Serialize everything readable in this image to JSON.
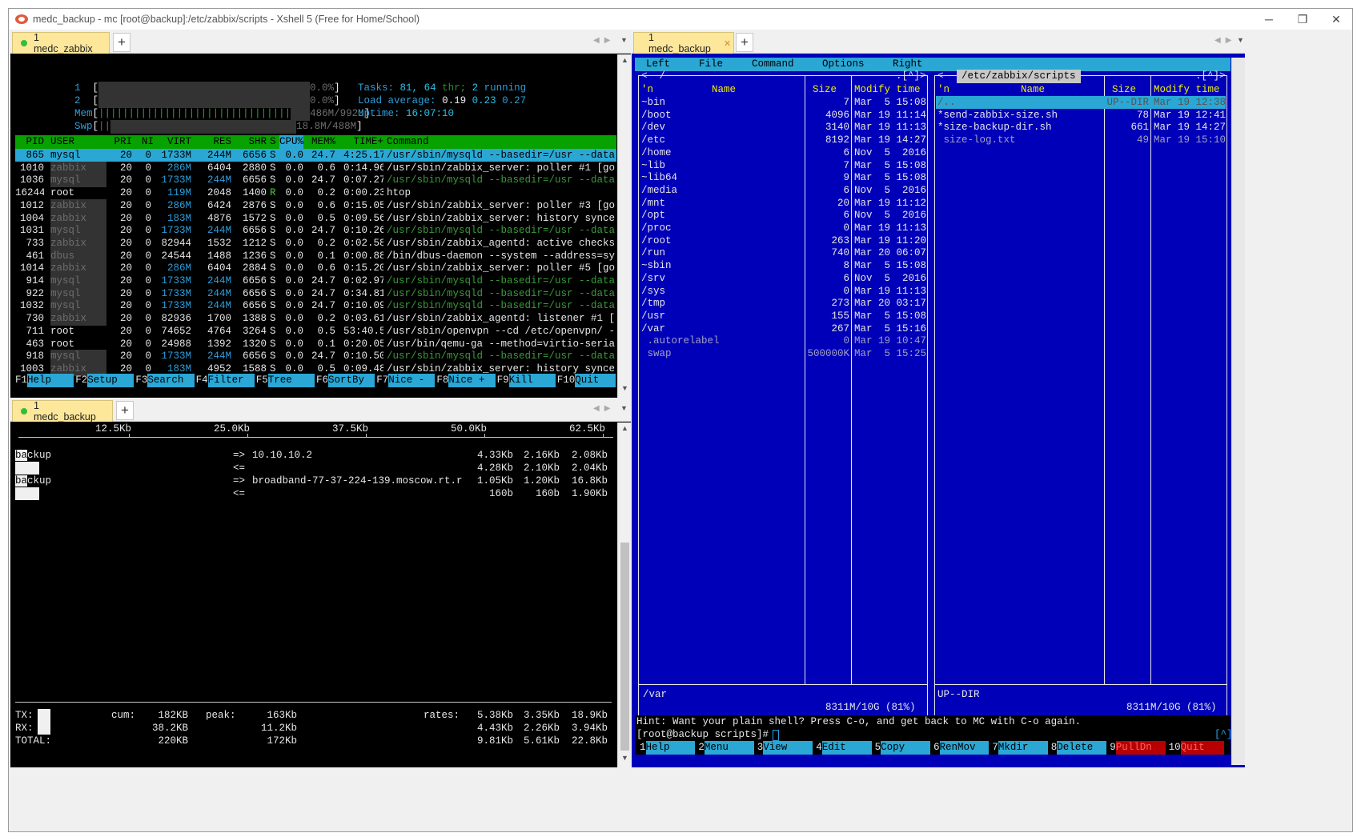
{
  "window": {
    "title": "medc_backup - mc [root@backup]:/etc/zabbix/scripts - Xshell 5 (Free for Home/School)",
    "controls": {
      "minimize": "─",
      "restore": "❐",
      "close": "✕"
    }
  },
  "colors": {
    "htop_header": "#07a100",
    "selection": "#2aa7d5",
    "mc_background": "#0000b8",
    "tab_active": "#fde79a"
  },
  "top_left_pane": {
    "tab_label": "1 medc_zabbix",
    "htop": {
      "cpu1": {
        "num": "1",
        "value": "0.0%"
      },
      "cpu2": {
        "num": "2",
        "value": "0.0%"
      },
      "mem": {
        "label": "Mem",
        "value": "486M/992M"
      },
      "swp": {
        "label": "Swp",
        "value": "18.8M/488M"
      },
      "tasks": {
        "label": "Tasks:",
        "count": "81,",
        "thr": "64",
        "thr_label": "thr;",
        "running": "2",
        "running_label": "running"
      },
      "load": {
        "label": "Load average:",
        "v1": "0.19",
        "v2": "0.23",
        "v3": "0.27"
      },
      "uptime": {
        "label": "Uptime:",
        "value": "16:07:10"
      },
      "columns": [
        "PID",
        "USER",
        "PRI",
        "NI",
        "VIRT",
        "RES",
        "SHR",
        "S",
        "CPU%",
        "MEM%",
        "TIME+",
        "Command"
      ],
      "rows": [
        [
          "865",
          "mysql",
          "20",
          "0",
          "1733M",
          "244M",
          "6656",
          "S",
          "0.0",
          "24.7",
          "4:25.17",
          "/usr/sbin/mysqld --basedir=/usr --data"
        ],
        [
          "1010",
          "zabbix",
          "20",
          "0",
          "286M",
          "6404",
          "2880",
          "S",
          "0.0",
          "0.6",
          "0:14.96",
          "/usr/sbin/zabbix_server: poller #1 [go"
        ],
        [
          "1036",
          "mysql",
          "20",
          "0",
          "1733M",
          "244M",
          "6656",
          "S",
          "0.0",
          "24.7",
          "0:07.27",
          "/usr/sbin/mysqld --basedir=/usr --data"
        ],
        [
          "16244",
          "root",
          "20",
          "0",
          "119M",
          "2048",
          "1400",
          "R",
          "0.0",
          "0.2",
          "0:00.23",
          "htop"
        ],
        [
          "1012",
          "zabbix",
          "20",
          "0",
          "286M",
          "6424",
          "2876",
          "S",
          "0.0",
          "0.6",
          "0:15.05",
          "/usr/sbin/zabbix_server: poller #3 [go"
        ],
        [
          "1004",
          "zabbix",
          "20",
          "0",
          "183M",
          "4876",
          "1572",
          "S",
          "0.0",
          "0.5",
          "0:09.56",
          "/usr/sbin/zabbix_server: history synce"
        ],
        [
          "1031",
          "mysql",
          "20",
          "0",
          "1733M",
          "244M",
          "6656",
          "S",
          "0.0",
          "24.7",
          "0:10.26",
          "/usr/sbin/mysqld --basedir=/usr --data"
        ],
        [
          "733",
          "zabbix",
          "20",
          "0",
          "82944",
          "1532",
          "1212",
          "S",
          "0.0",
          "0.2",
          "0:02.58",
          "/usr/sbin/zabbix_agentd: active checks"
        ],
        [
          "461",
          "dbus",
          "20",
          "0",
          "24544",
          "1488",
          "1236",
          "S",
          "0.0",
          "0.1",
          "0:00.88",
          "/bin/dbus-daemon --system --address=sy"
        ],
        [
          "1014",
          "zabbix",
          "20",
          "0",
          "286M",
          "6404",
          "2884",
          "S",
          "0.0",
          "0.6",
          "0:15.20",
          "/usr/sbin/zabbix_server: poller #5 [go"
        ],
        [
          "914",
          "mysql",
          "20",
          "0",
          "1733M",
          "244M",
          "6656",
          "S",
          "0.0",
          "24.7",
          "0:02.97",
          "/usr/sbin/mysqld --basedir=/usr --data"
        ],
        [
          "922",
          "mysql",
          "20",
          "0",
          "1733M",
          "244M",
          "6656",
          "S",
          "0.0",
          "24.7",
          "0:34.81",
          "/usr/sbin/mysqld --basedir=/usr --data"
        ],
        [
          "1032",
          "mysql",
          "20",
          "0",
          "1733M",
          "244M",
          "6656",
          "S",
          "0.0",
          "24.7",
          "0:10.09",
          "/usr/sbin/mysqld --basedir=/usr --data"
        ],
        [
          "730",
          "zabbix",
          "20",
          "0",
          "82936",
          "1700",
          "1388",
          "S",
          "0.0",
          "0.2",
          "0:03.61",
          "/usr/sbin/zabbix_agentd: listener #1 ["
        ],
        [
          "711",
          "root",
          "20",
          "0",
          "74652",
          "4764",
          "3264",
          "S",
          "0.0",
          "0.5",
          "53:40.54",
          "/usr/sbin/openvpn --cd /etc/openvpn/ -"
        ],
        [
          "463",
          "root",
          "20",
          "0",
          "24988",
          "1392",
          "1320",
          "S",
          "0.0",
          "0.1",
          "0:20.05",
          "/usr/bin/qemu-ga --method=virtio-seria"
        ],
        [
          "918",
          "mysql",
          "20",
          "0",
          "1733M",
          "244M",
          "6656",
          "S",
          "0.0",
          "24.7",
          "0:10.50",
          "/usr/sbin/mysqld --basedir=/usr --data"
        ],
        [
          "1003",
          "zabbix",
          "20",
          "0",
          "183M",
          "4952",
          "1588",
          "S",
          "0.0",
          "0.5",
          "0:09.48",
          "/usr/sbin/zabbix_server: history synce"
        ]
      ],
      "fkeys": [
        {
          "key": "F1",
          "label": "Help"
        },
        {
          "key": "F2",
          "label": "Setup"
        },
        {
          "key": "F3",
          "label": "Search"
        },
        {
          "key": "F4",
          "label": "Filter"
        },
        {
          "key": "F5",
          "label": "Tree"
        },
        {
          "key": "F6",
          "label": "SortBy"
        },
        {
          "key": "F7",
          "label": "Nice -"
        },
        {
          "key": "F8",
          "label": "Nice +"
        },
        {
          "key": "F9",
          "label": "Kill"
        },
        {
          "key": "F10",
          "label": "Quit"
        }
      ]
    }
  },
  "bottom_left_pane": {
    "tab_label": "1 medc_backup",
    "iftop": {
      "scale": [
        "12.5Kb",
        "25.0Kb",
        "37.5Kb",
        "50.0Kb",
        "62.5Kb"
      ],
      "flows": [
        {
          "host": "backup",
          "dir1": "=>",
          "peer": "10.10.10.2",
          "out": [
            "4.33Kb",
            "2.16Kb",
            "2.08Kb"
          ],
          "dir2": "<=",
          "in": [
            "4.28Kb",
            "2.10Kb",
            "2.04Kb"
          ]
        },
        {
          "host": "backup",
          "dir1": "=>",
          "peer": "broadband-77-37-224-139.moscow.rt.r",
          "out": [
            "1.05Kb",
            "1.20Kb",
            "16.8Kb"
          ],
          "dir2": "<=",
          "in": [
            "160b",
            "160b",
            "1.90Kb"
          ]
        }
      ],
      "totals": {
        "tx_label": "TX:",
        "rx_label": "RX:",
        "total_label": "TOTAL:",
        "cum_label": "cum:",
        "peak_label": "peak:",
        "rates_label": "rates:",
        "tx": {
          "cum": "182KB",
          "peak": "163Kb",
          "rates": [
            "5.38Kb",
            "3.35Kb",
            "18.9Kb"
          ]
        },
        "rx": {
          "cum": "38.2KB",
          "peak": "11.2Kb",
          "rates": [
            "4.43Kb",
            "2.26Kb",
            "3.94Kb"
          ]
        },
        "total": {
          "cum": "220KB",
          "peak": "172Kb",
          "rates": [
            "9.81Kb",
            "5.61Kb",
            "22.8Kb"
          ]
        }
      }
    }
  },
  "right_pane": {
    "tab_label": "1 medc_backup",
    "mc": {
      "menu": [
        "Left",
        "File",
        "Command",
        "Options",
        "Right"
      ],
      "left_panel": {
        "path": "<- /",
        "corner": ".[^]>",
        "header": {
          "n": "'n",
          "name": "Name",
          "size": "Size",
          "mtime": "Modify time"
        },
        "files": [
          [
            "~bin",
            "7",
            "Mar  5 15:08"
          ],
          [
            "/boot",
            "4096",
            "Mar 19 11:14"
          ],
          [
            "/dev",
            "3140",
            "Mar 19 11:13"
          ],
          [
            "/etc",
            "8192",
            "Mar 19 14:27"
          ],
          [
            "/home",
            "6",
            "Nov  5  2016"
          ],
          [
            "~lib",
            "7",
            "Mar  5 15:08"
          ],
          [
            "~lib64",
            "9",
            "Mar  5 15:08"
          ],
          [
            "/media",
            "6",
            "Nov  5  2016"
          ],
          [
            "/mnt",
            "20",
            "Mar 19 11:12"
          ],
          [
            "/opt",
            "6",
            "Nov  5  2016"
          ],
          [
            "/proc",
            "0",
            "Mar 19 11:13"
          ],
          [
            "/root",
            "263",
            "Mar 19 11:20"
          ],
          [
            "/run",
            "740",
            "Mar 20 06:07"
          ],
          [
            "~sbin",
            "8",
            "Mar  5 15:08"
          ],
          [
            "/srv",
            "6",
            "Nov  5  2016"
          ],
          [
            "/sys",
            "0",
            "Mar 19 11:13"
          ],
          [
            "/tmp",
            "273",
            "Mar 20 03:17"
          ],
          [
            "/usr",
            "155",
            "Mar  5 15:08"
          ],
          [
            "/var",
            "267",
            "Mar  5 15:16"
          ],
          [
            " .autorelabel",
            "0",
            "Mar 19 10:47"
          ],
          [
            " swap",
            "500000K",
            "Mar  5 15:25"
          ]
        ],
        "status": "/var",
        "free": "8311M/10G (81%)"
      },
      "right_panel": {
        "path": "/etc/zabbix/scripts",
        "corner_left": "<-",
        "corner": ".[^]>",
        "header": {
          "n": "'n",
          "name": "Name",
          "size": "Size",
          "mtime": "Modify time"
        },
        "files": [
          [
            "/..",
            "UP--DIR",
            "Mar 19 12:38"
          ],
          [
            "*send-zabbix-size.sh",
            "78",
            "Mar 19 12:41"
          ],
          [
            "*size-backup-dir.sh",
            "661",
            "Mar 19 14:27"
          ],
          [
            " size-log.txt",
            "49",
            "Mar 19 15:10"
          ]
        ],
        "status": "UP--DIR",
        "free": "8311M/10G (81%)"
      },
      "hint": "Hint: Want your plain shell? Press C-o, and get back to MC with C-o again.",
      "prompt": "[root@backup scripts]#",
      "prompt_corner": "[^]",
      "fkeys": [
        {
          "key": "1",
          "label": "Help"
        },
        {
          "key": "2",
          "label": "Menu"
        },
        {
          "key": "3",
          "label": "View"
        },
        {
          "key": "4",
          "label": "Edit"
        },
        {
          "key": "5",
          "label": "Copy"
        },
        {
          "key": "6",
          "label": "RenMov"
        },
        {
          "key": "7",
          "label": "Mkdir"
        },
        {
          "key": "8",
          "label": "Delete"
        },
        {
          "key": "9",
          "label": "PullDn"
        },
        {
          "key": "10",
          "label": "Quit"
        }
      ]
    }
  }
}
